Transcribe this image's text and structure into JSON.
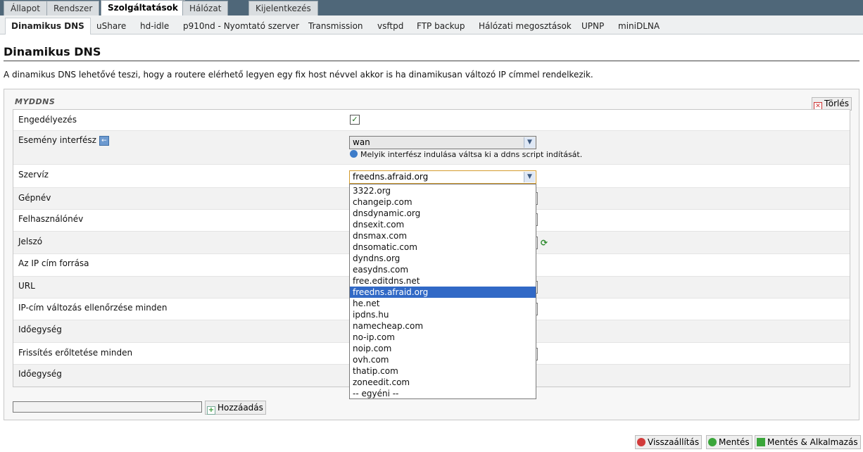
{
  "top_tabs": [
    "Állapot",
    "Rendszer",
    "Szolgáltatások",
    "Hálózat",
    "Kijelentkezés"
  ],
  "sub_tabs": [
    "Dinamikus DNS",
    "uShare",
    "hd-idle",
    "p910nd - Nyomtató szerver",
    "Transmission",
    "vsftpd",
    "FTP backup",
    "Hálózati megosztások",
    "UPNP",
    "miniDLNA"
  ],
  "page": {
    "title": "Dinamikus DNS",
    "description": "A dinamikus DNS lehetővé teszi, hogy a routere elérhető legyen egy fix host névvel akkor is ha dinamikusan változó IP címmel rendelkezik."
  },
  "section": {
    "legend": "MYDDNS",
    "delete_label": "Törlés"
  },
  "fields": {
    "enable_label": "Engedélyezés",
    "enable_checked": true,
    "enable_mark": "✓",
    "event_iface_label": "Esemény interfész",
    "event_iface_value": "wan",
    "event_iface_hint": "Melyik interfész indulása váltsa ki a ddns script indítását.",
    "service_label": "Szervíz",
    "service_value": "freedns.afraid.org",
    "hostname_label": "Gépnév",
    "username_label": "Felhasználónév",
    "password_label": "Jelszó",
    "ip_source_label": "Az IP cím forrása",
    "url_label": "URL",
    "check_interval_label": "IP-cím változás ellenőrzése minden",
    "unit_label_1": "Időegység",
    "force_interval_label": "Frissítés erőltetése minden",
    "unit_label_2": "Időegység"
  },
  "service_options": [
    "3322.org",
    "changeip.com",
    "dnsdynamic.org",
    "dnsexit.com",
    "dnsmax.com",
    "dnsomatic.com",
    "dyndns.org",
    "easydns.com",
    "free.editdns.net",
    "freedns.afraid.org",
    "he.net",
    "ipdns.hu",
    "namecheap.com",
    "no-ip.com",
    "noip.com",
    "ovh.com",
    "thatip.com",
    "zoneedit.com",
    "-- egyéni --"
  ],
  "selected_option": "freedns.afraid.org",
  "add": {
    "input_value": "",
    "button_label": "Hozzáadás"
  },
  "footer": {
    "reset_label": "Visszaállítás",
    "save_label": "Mentés",
    "save_apply_label": "Mentés & Alkalmazás"
  }
}
